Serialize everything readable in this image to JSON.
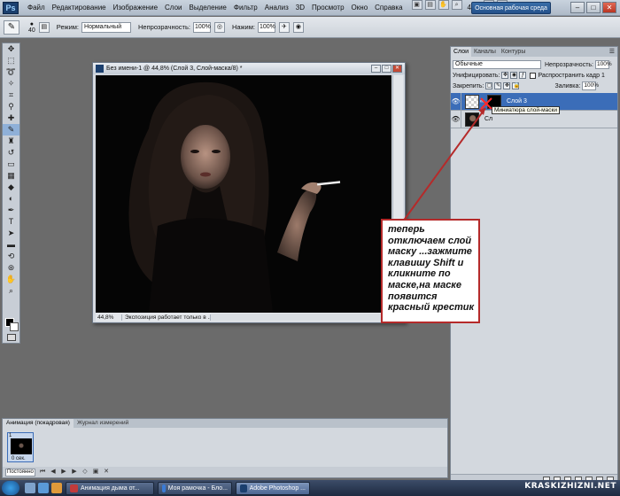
{
  "app": {
    "logo": "Ps"
  },
  "menubar": {
    "items": [
      "Файл",
      "Редактирование",
      "Изображение",
      "Слои",
      "Выделение",
      "Фильтр",
      "Анализ",
      "3D",
      "Просмотр",
      "Окно",
      "Справка"
    ],
    "zoom": "44,8",
    "workspace": "Основная рабочая среда"
  },
  "options": {
    "brush_size": "40",
    "mode_label": "Режим:",
    "mode_value": "Нормальный",
    "opacity_label": "Непрозрачность:",
    "opacity_value": "100%",
    "flow_label": "Нажим:",
    "flow_value": "100%"
  },
  "document": {
    "title": "Без имени-1 @ 44,8% (Слой 3, Слой-маска/8) *",
    "status_zoom": "44,8%",
    "status_info": "Экспозиция работает только в ..."
  },
  "callout": {
    "text": "теперь отключаем слой маску ...зажмите клавишу Shift  и кликните по маске,на маске появится красный крестик"
  },
  "layers_panel": {
    "tabs": [
      "Слои",
      "Каналы",
      "Контуры"
    ],
    "blend_mode": "Обычные",
    "opacity_label": "Непрозрачность:",
    "opacity_value": "100%",
    "unify_label": "Унифицировать:",
    "propagate_label": "Распространить кадр 1",
    "lock_label": "Закрепить:",
    "fill_label": "Заливка:",
    "fill_value": "100%",
    "layers": [
      {
        "name": "Слой 3",
        "selected": true
      },
      {
        "name": "Сл",
        "selected": false
      }
    ],
    "tooltip": "Миниатюра слой-маски"
  },
  "animation_panel": {
    "tabs": [
      "Анимация (покадровая)",
      "Журнал измерений"
    ],
    "frame_number": "1",
    "frame_time": "0 сек.",
    "loop": "Постоянно"
  },
  "taskbar": {
    "tasks": [
      {
        "label": "Анимация дыма от...",
        "color": "#c23b3b"
      },
      {
        "label": "Моя рамочка - Бло...",
        "color": "#3a7bd5"
      },
      {
        "label": "Adobe Photoshop ...",
        "color": "#1b3f6e"
      }
    ],
    "watermark": "KRASKIZHIZNI.NET"
  }
}
